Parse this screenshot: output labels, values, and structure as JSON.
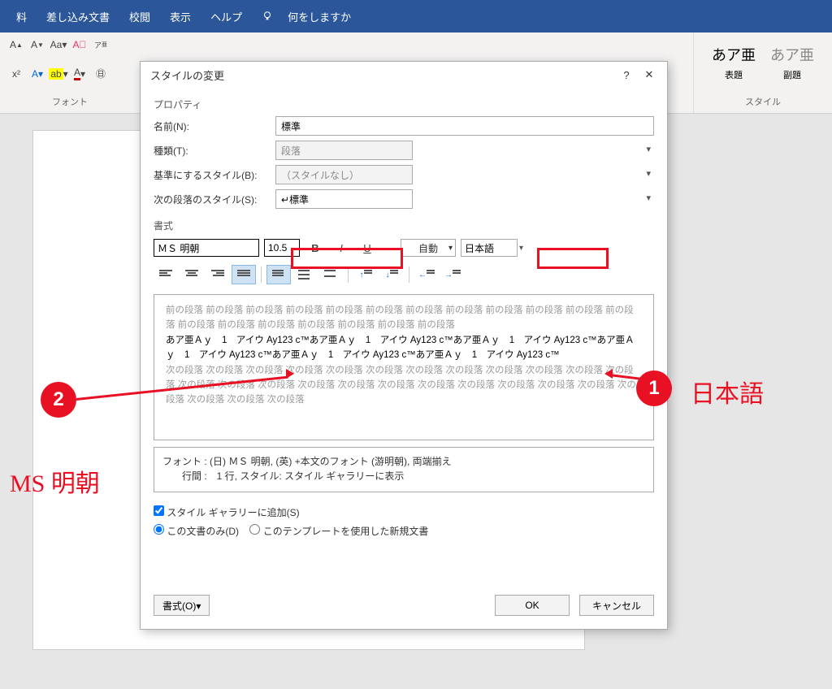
{
  "ribbon": {
    "tabs": [
      "料",
      "差し込み文書",
      "校閲",
      "表示",
      "ヘルプ"
    ],
    "tell_me": "何をしますか",
    "group_font": "フォント",
    "group_style": "スタイル",
    "styles": [
      {
        "preview": "あア亜",
        "label": "表題"
      },
      {
        "preview": "あア亜",
        "label": "副題"
      }
    ]
  },
  "dialog": {
    "title": "スタイルの変更",
    "section_properties": "プロパティ",
    "labels": {
      "name": "名前(N):",
      "type": "種類(T):",
      "based_on": "基準にするスタイル(B):",
      "next_para": "次の段落のスタイル(S):"
    },
    "values": {
      "name": "標準",
      "type": "段落",
      "based_on": "（スタイルなし）",
      "next_para": "↵標準"
    },
    "section_format": "書式",
    "font": "ＭＳ 明朝",
    "size": "10.5",
    "auto_color": "自動",
    "language": "日本語",
    "preview": {
      "before": "前の段落 前の段落 前の段落 前の段落 前の段落 前の段落 前の段落 前の段落 前の段落 前の段落 前の段落 前の段落 前の段落 前の段落 前の段落 前の段落 前の段落 前の段落 前の段落",
      "main": "あア亜Ａｙ　1　アイウ Ay123 c™あア亜Ａｙ　1　アイウ Ay123 c™あア亜Ａｙ　1　アイウ Ay123 c™あア亜Ａｙ　1　アイウ Ay123 c™あア亜Ａｙ　1　アイウ Ay123 c™あア亜Ａｙ　1　アイウ Ay123 c™",
      "after": "次の段落 次の段落 次の段落 次の段落 次の段落 次の段落 次の段落 次の段落 次の段落 次の段落 次の段落 次の段落 次の段落 次の段落 次の段落 次の段落 次の段落 次の段落 次の段落 次の段落 次の段落 次の段落 次の段落 次の段落 次の段落 次の段落 次の段落"
    },
    "description": {
      "line1": "フォント : (日) ＭＳ 明朝, (英) +本文のフォント (游明朝), 両端揃え",
      "line2": "　　行間 :　1 行, スタイル: スタイル ギャラリーに表示"
    },
    "add_to_gallery": "スタイル ギャラリーに追加(S)",
    "this_doc_only": "この文書のみ(D)",
    "new_docs": "このテンプレートを使用した新規文書",
    "format_menu": "書式(O)▾",
    "ok": "OK",
    "cancel": "キャンセル"
  },
  "callouts": {
    "one_label": "1",
    "one_text": "日本語",
    "two_label": "2",
    "two_text": "MS 明朝"
  }
}
